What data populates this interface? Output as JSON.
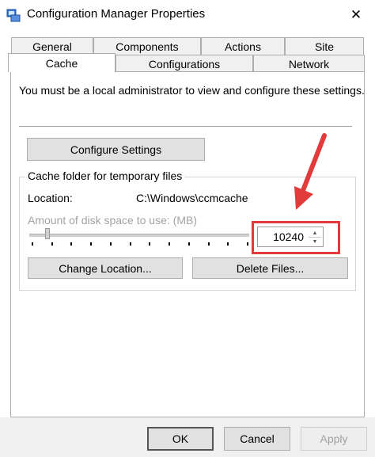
{
  "window": {
    "title": "Configuration Manager Properties",
    "close_glyph": "✕"
  },
  "tabs": {
    "row1": [
      {
        "label": "General"
      },
      {
        "label": "Components"
      },
      {
        "label": "Actions"
      },
      {
        "label": "Site"
      }
    ],
    "row2": [
      {
        "label": "Cache",
        "active": true
      },
      {
        "label": "Configurations"
      },
      {
        "label": "Network"
      }
    ]
  },
  "panel": {
    "admin_message": "You must be a local administrator to view and configure these settings.",
    "configure_button": "Configure Settings",
    "group_title": "Cache folder for temporary files",
    "location_label": "Location:",
    "location_value": "C:\\Windows\\ccmcache",
    "disk_label": "Amount of disk space to use: (MB)",
    "disk_value": "10240",
    "spin_up_glyph": "▲",
    "spin_down_glyph": "▼",
    "change_location_button": "Change Location...",
    "delete_files_button": "Delete Files..."
  },
  "footer": {
    "ok": "OK",
    "cancel": "Cancel",
    "apply": "Apply"
  },
  "annotations": {
    "arrow_color": "#e23b3b",
    "highlight_color": "#e23b3b"
  }
}
